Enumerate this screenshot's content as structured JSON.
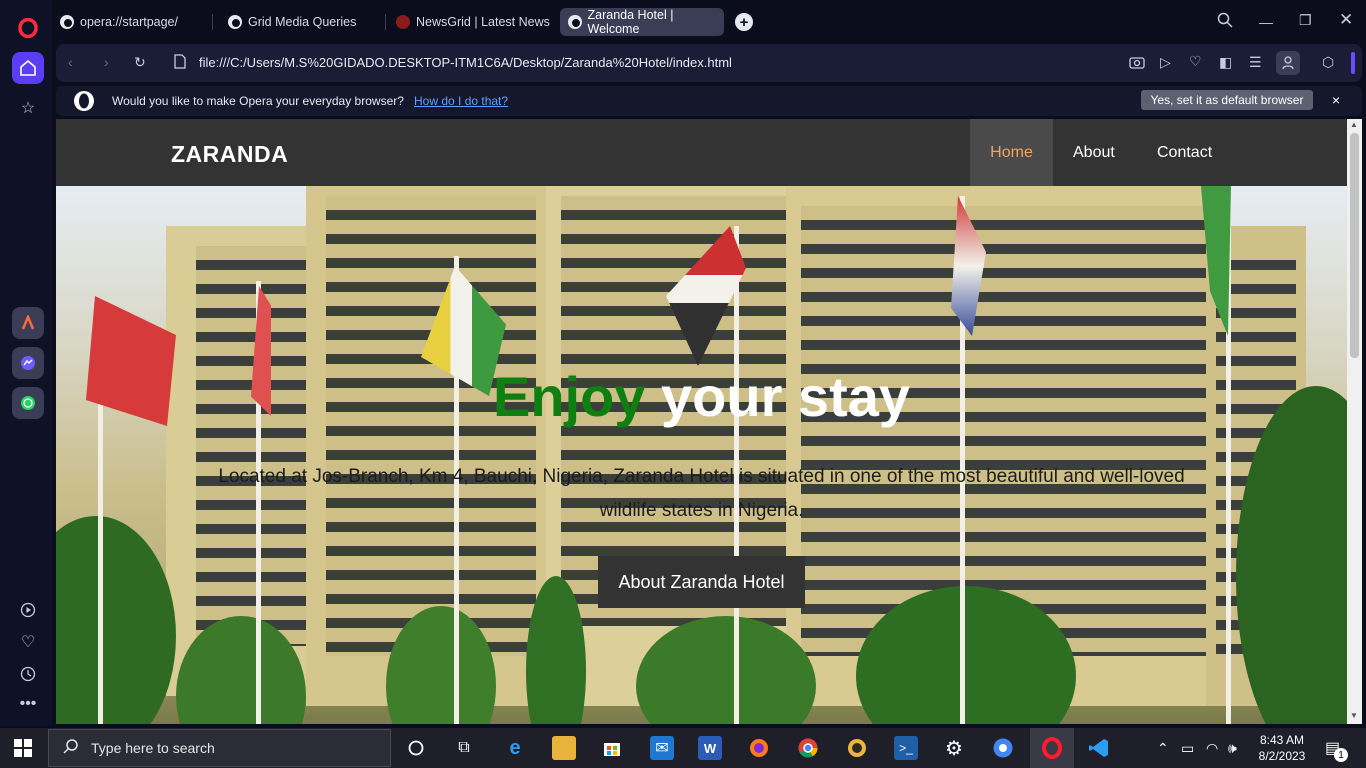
{
  "browser": {
    "tabs": [
      {
        "title": "opera://startpage/"
      },
      {
        "title": "Grid Media Queries"
      },
      {
        "title": "NewsGrid | Latest News"
      },
      {
        "title": "Zaranda Hotel | Welcome",
        "active": true
      }
    ],
    "new_tab_symbol": "+",
    "url": "file:///C:/Users/M.S%20GIDADO.DESKTOP-ITM1C6A/Desktop/Zaranda%20Hotel/index.html",
    "infobar": {
      "message": "Would you like to make Opera your everyday browser?",
      "link": "How do I do that?",
      "button": "Yes, set it as default browser",
      "close": "×"
    }
  },
  "site": {
    "brand": "ZARANDA",
    "nav": [
      "Home",
      "About",
      "Contact"
    ],
    "hero": {
      "title_highlight": "Enjoy",
      "title_rest": " your stay",
      "description": "Located at Jos-Branch, Km 4, Bauchi, Nigeria, Zaranda Hotel is situated in one of the most beautiful and well-loved wildlife states in Nigeria.",
      "button": "About Zaranda Hotel"
    }
  },
  "taskbar": {
    "search_placeholder": "Type here to search",
    "time": "8:43 AM",
    "date": "8/2/2023",
    "notification_count": "1"
  },
  "colors": {
    "highlight_green": "#0f7f12",
    "active_nav": "#f4a460",
    "navbar_bg": "#333333"
  }
}
